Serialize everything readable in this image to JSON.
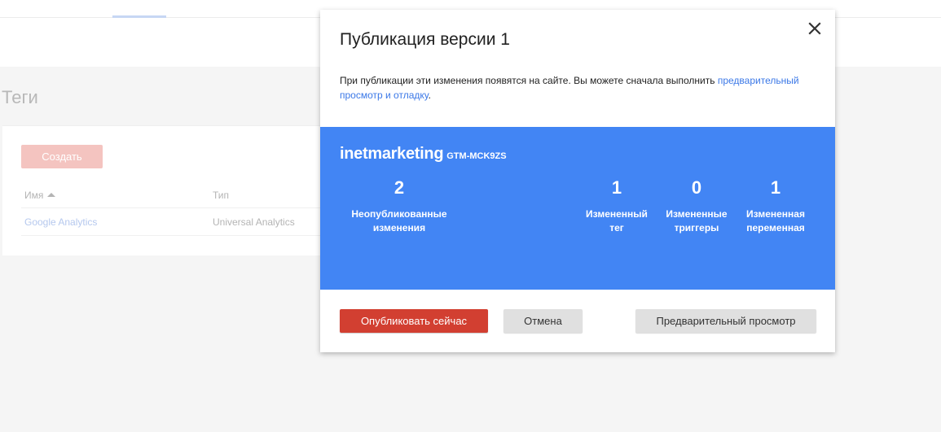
{
  "background": {
    "page_title": "Теги",
    "create_button": "Создать",
    "table": {
      "columns": [
        "Имя",
        "Тип"
      ],
      "rows": [
        {
          "name": "Google Analytics",
          "type": "Universal Analytics"
        }
      ]
    }
  },
  "dialog": {
    "title": "Публикация версии 1",
    "description": "При публикации эти изменения появятся на сайте. Вы можете сначала выполнить ",
    "description_link": "предварительный просмотр и отладку",
    "description_end": ".",
    "container_name": "inetmarketing",
    "container_id": "GTM-MCK9ZS",
    "stats": {
      "unpublished": {
        "value": "2",
        "label_line1": "Неопубликованные",
        "label_line2": "изменения"
      },
      "tag": {
        "value": "1",
        "label_line1": "Измененный",
        "label_line2": "тег"
      },
      "triggers": {
        "value": "0",
        "label_line1": "Измененные",
        "label_line2": "триггеры"
      },
      "variable": {
        "value": "1",
        "label_line1": "Измененная",
        "label_line2": "переменная"
      }
    },
    "buttons": {
      "publish": "Опубликовать сейчас",
      "cancel": "Отмена",
      "preview": "Предварительный просмотр"
    }
  },
  "colors": {
    "accent_blue": "#4285f4",
    "publish_red": "#d23f31",
    "link_blue": "#3b78e7"
  },
  "icons": {
    "close": "close-icon",
    "sort": "sort-ascending-icon"
  }
}
